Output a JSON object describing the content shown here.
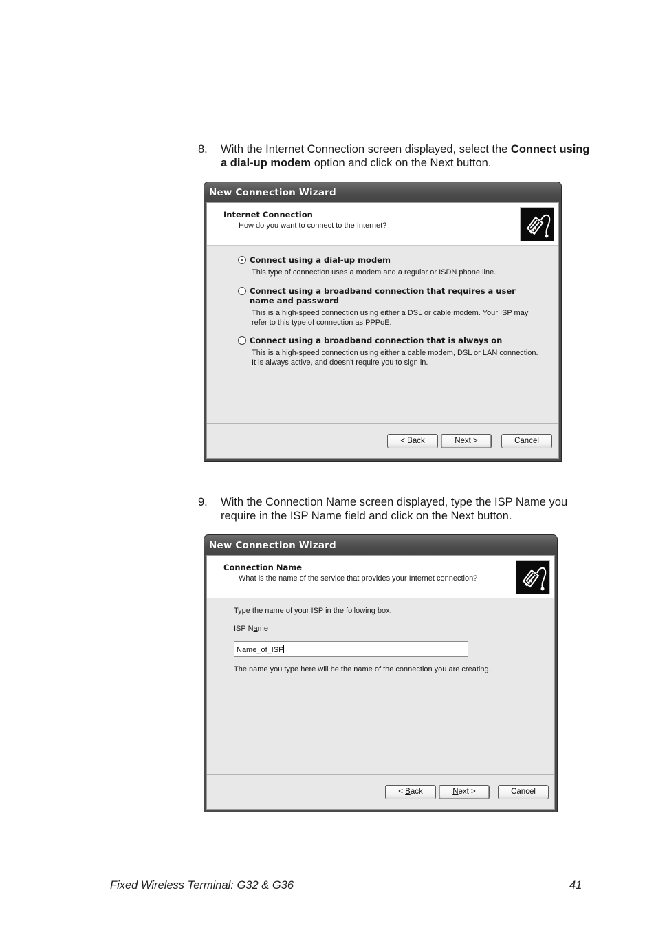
{
  "steps": [
    {
      "number": "8.",
      "text_before": "With the Internet Connection screen displayed, select the ",
      "bold": "Connect using a dial-up modem",
      "text_after": " option and click on the Next button."
    },
    {
      "number": "9.",
      "text": "With the Connection Name screen displayed, type the ISP Name you require in the ISP Name field and click on the Next button."
    }
  ],
  "dialog1": {
    "title": "New Connection Wizard",
    "header_title": "Internet Connection",
    "header_subtitle": "How do you want to connect to the Internet?",
    "header_icon": "network-cable-icon",
    "options": [
      {
        "label": "Connect using a dial-up modem",
        "description": "This type of connection uses a modem and a regular or ISDN phone line.",
        "selected": true
      },
      {
        "label": "Connect using a broadband connection that requires a user name and password",
        "description": "This is a high-speed connection using either a DSL or cable modem. Your ISP may refer to this type of connection as PPPoE.",
        "selected": false
      },
      {
        "label": "Connect using a broadband connection that is always on",
        "description": "This is a high-speed connection using either a cable modem, DSL or LAN connection. It is always active, and doesn't require you to sign in.",
        "selected": false
      }
    ],
    "buttons": {
      "back": "< Back",
      "next": "Next >",
      "cancel": "Cancel"
    }
  },
  "dialog2": {
    "title": "New Connection Wizard",
    "header_title": "Connection Name",
    "header_subtitle": "What is the name of the service that provides your Internet connection?",
    "header_icon": "network-cable-icon",
    "instruction": "Type the name of your ISP in the following box.",
    "field_label": "ISP Name",
    "field_value": "Name_of_ISP",
    "note": "The name you type here will be the name of the connection you are creating.",
    "buttons": {
      "back": "< Back",
      "next": "Next >",
      "cancel": "Cancel"
    }
  },
  "footer": {
    "title": "Fixed Wireless Terminal: G32 & G36",
    "page_number": "41"
  }
}
